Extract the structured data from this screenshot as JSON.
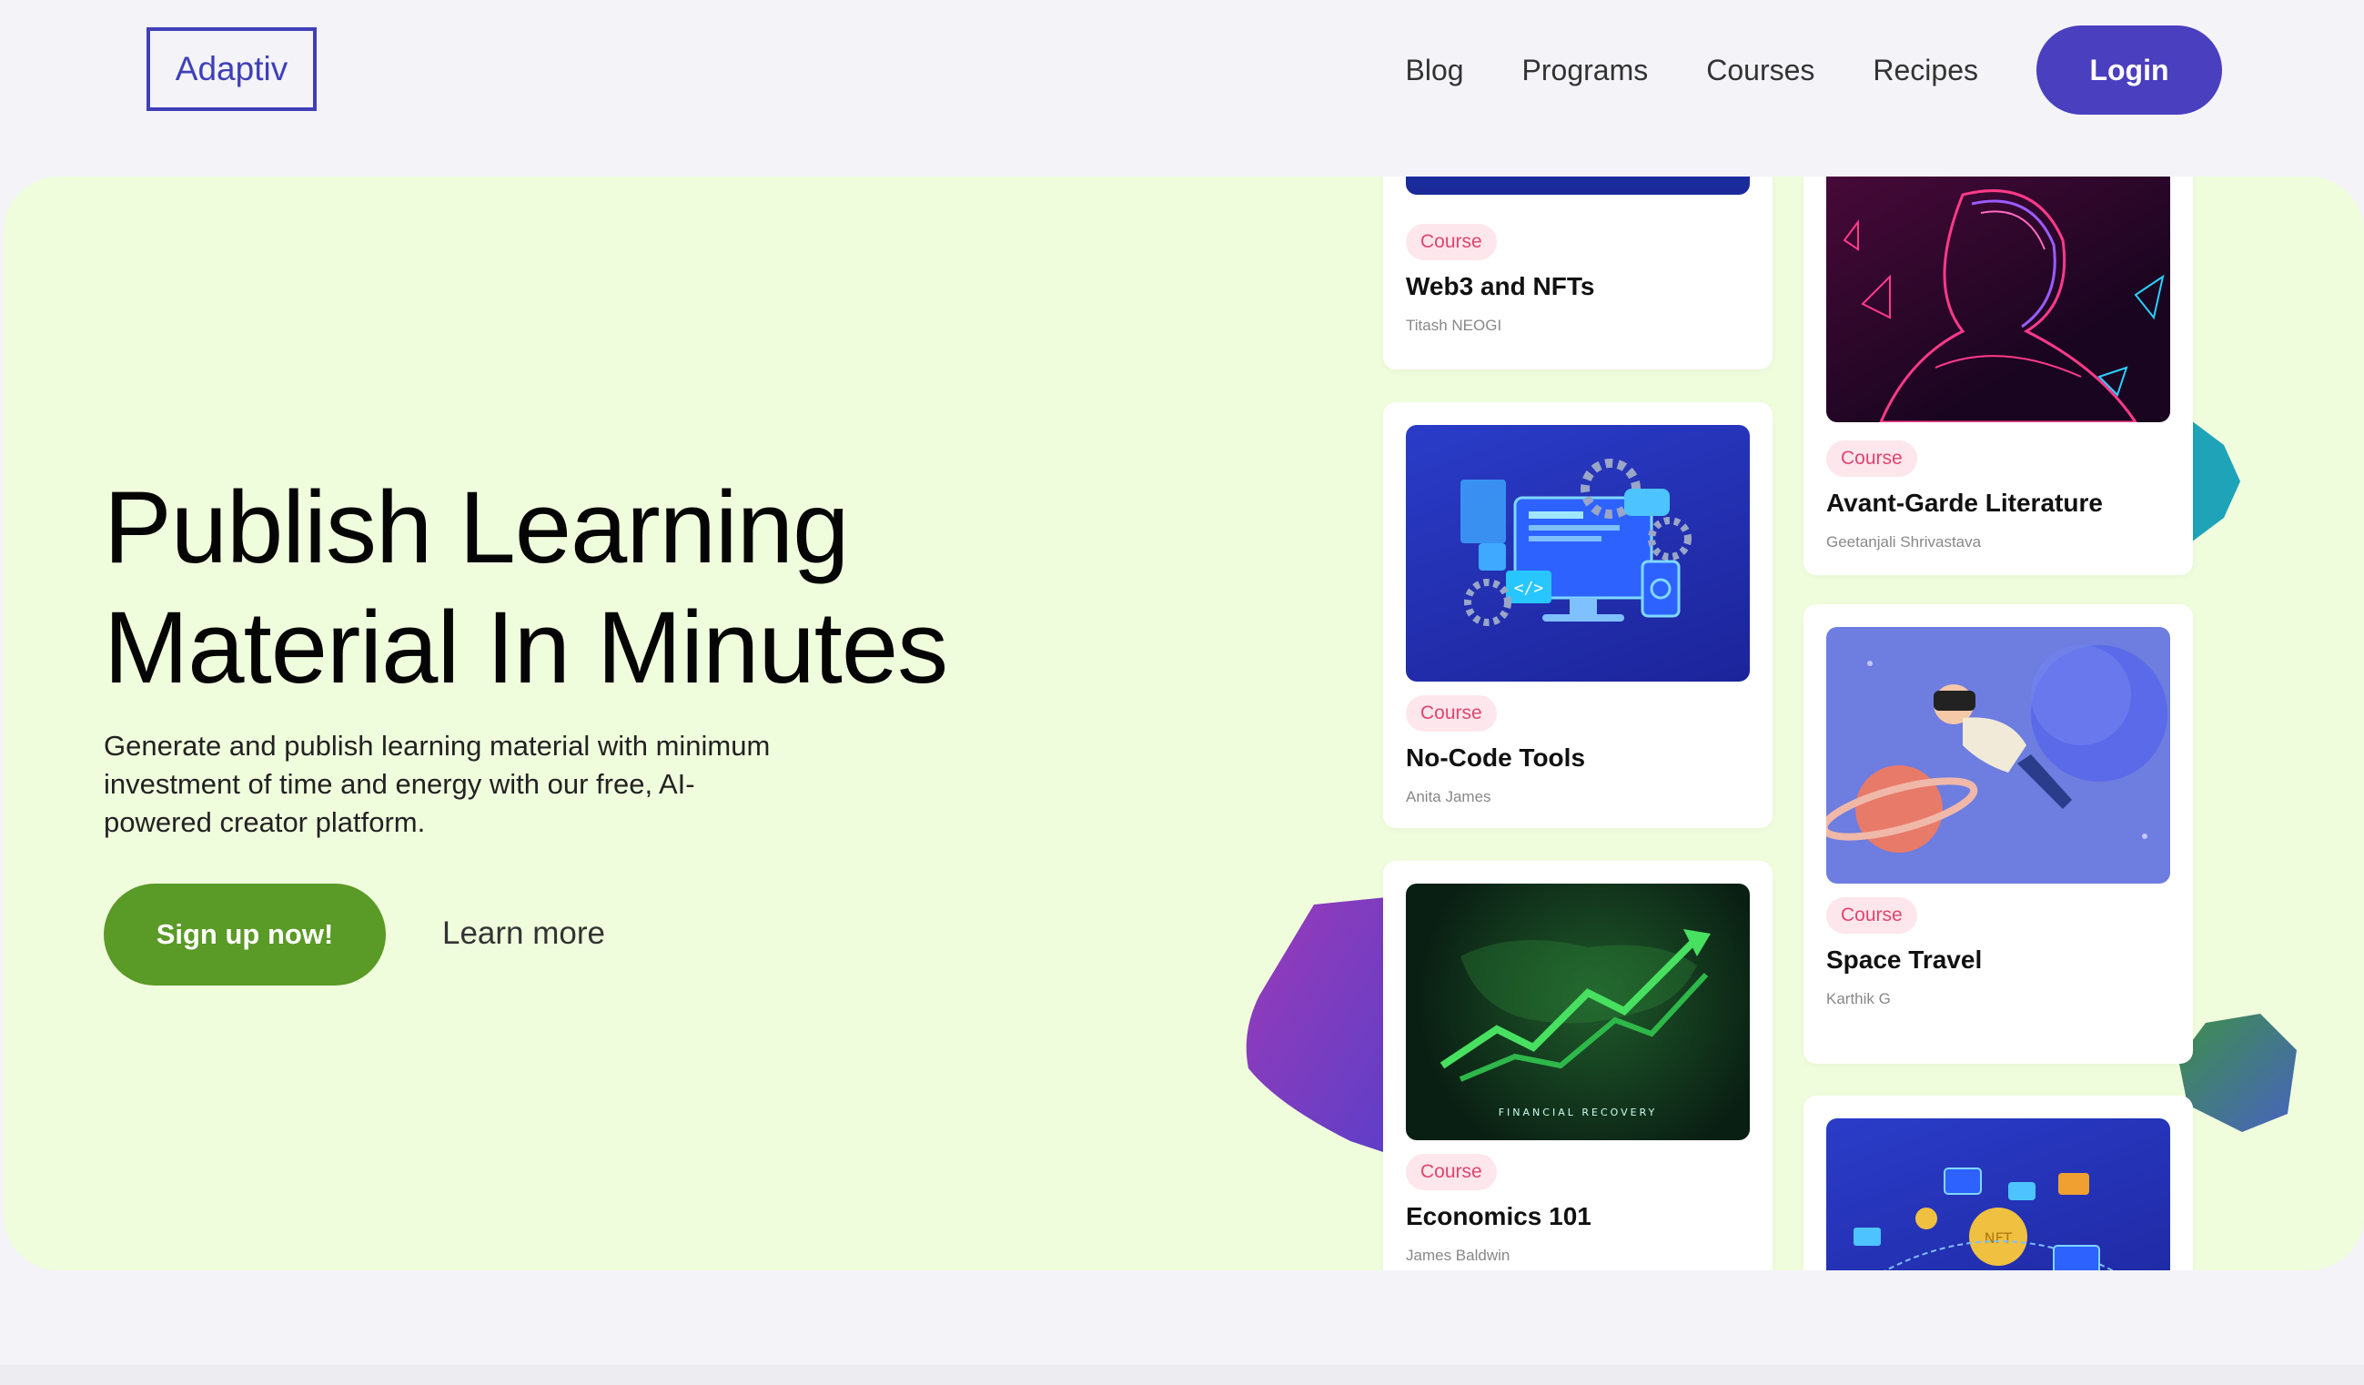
{
  "brand": {
    "logo": "Adaptiv"
  },
  "nav": {
    "items": [
      "Blog",
      "Programs",
      "Courses",
      "Recipes"
    ],
    "login_label": "Login"
  },
  "hero": {
    "headline_line1": "Publish Learning",
    "headline_line2": "Material In Minutes",
    "subtext": "Generate and publish learning material with minimum investment of time and energy with our free, AI-powered creator platform.",
    "cta_primary": "Sign up now!",
    "cta_secondary": "Learn more"
  },
  "cards": [
    {
      "tag": "Course",
      "title": "Web3 and NFTs",
      "author": "Titash NEOGI"
    },
    {
      "tag": "Course",
      "title": "No-Code Tools",
      "author": "Anita James"
    },
    {
      "tag": "Course",
      "title": "Economics 101",
      "author": "James Baldwin",
      "image_caption": "FINANCIAL RECOVERY"
    },
    {
      "tag": "Course",
      "title": "Avant-Garde Literature",
      "author": "Geetanjali Shrivastava"
    },
    {
      "tag": "Course",
      "title": "Space Travel",
      "author": "Karthik G"
    },
    {
      "image_label": "NFT"
    }
  ],
  "colors": {
    "brand": "#3f3fb8",
    "login_bg": "#4a3fbf",
    "hero_bg": "#f0fddd",
    "signup_bg": "#5a9a26",
    "tag_text": "#e0456e",
    "tag_bg": "#fde6ec"
  }
}
